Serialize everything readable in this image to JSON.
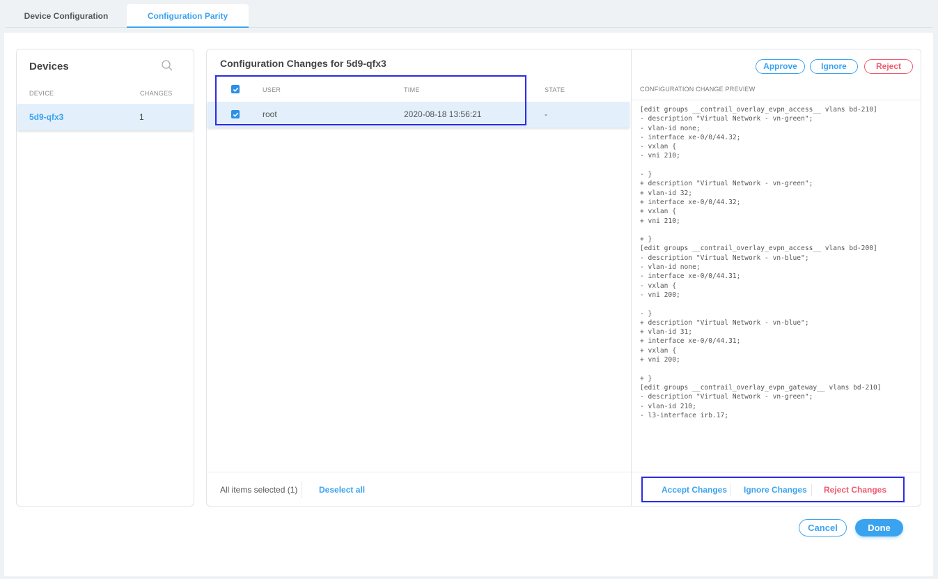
{
  "tabs": [
    {
      "label": "Device Configuration",
      "active": false
    },
    {
      "label": "Configuration Parity",
      "active": true
    }
  ],
  "devices": {
    "title": "Devices",
    "columns": [
      "DEVICE",
      "CHANGES"
    ],
    "rows": [
      {
        "device": "5d9-qfx3",
        "changes": "1",
        "selected": true
      }
    ]
  },
  "changes": {
    "title": "Configuration Changes for 5d9-qfx3",
    "columns": [
      "USER",
      "TIME",
      "STATE"
    ],
    "rows": [
      {
        "user": "root",
        "time": "2020-08-18 13:56:21",
        "state": "-",
        "checked": true
      }
    ],
    "header_checked": true,
    "selection_text": "All items selected (1)",
    "deselect_label": "Deselect all"
  },
  "preview": {
    "buttons": {
      "approve": "Approve",
      "ignore": "Ignore",
      "reject": "Reject"
    },
    "label": "CONFIGURATION CHANGE PREVIEW",
    "lines": [
      "[edit groups __contrail_overlay_evpn_access__ vlans bd-210]",
      "- description \"Virtual Network - vn-green\";",
      "- vlan-id none;",
      "- interface xe-0/0/44.32;",
      "- vxlan {",
      "- vni 210;",
      "",
      "- }",
      "+ description \"Virtual Network - vn-green\";",
      "+ vlan-id 32;",
      "+ interface xe-0/0/44.32;",
      "+ vxlan {",
      "+ vni 210;",
      "",
      "+ }",
      "[edit groups __contrail_overlay_evpn_access__ vlans bd-200]",
      "- description \"Virtual Network - vn-blue\";",
      "- vlan-id none;",
      "- interface xe-0/0/44.31;",
      "- vxlan {",
      "- vni 200;",
      "",
      "- }",
      "+ description \"Virtual Network - vn-blue\";",
      "+ vlan-id 31;",
      "+ interface xe-0/0/44.31;",
      "+ vxlan {",
      "+ vni 200;",
      "",
      "+ }",
      "[edit groups __contrail_overlay_evpn_gateway__ vlans bd-210]",
      "- description \"Virtual Network - vn-green\";",
      "- vlan-id 210;",
      "- l3-interface irb.17;"
    ],
    "actions": {
      "accept": "Accept Changes",
      "ignore": "Ignore Changes",
      "reject": "Reject Changes"
    }
  },
  "footer": {
    "cancel": "Cancel",
    "done": "Done"
  },
  "colors": {
    "accent": "#3aa3f0",
    "danger": "#ef5b6e",
    "selected_row": "#e3effb",
    "highlight": "#2b2be6"
  }
}
